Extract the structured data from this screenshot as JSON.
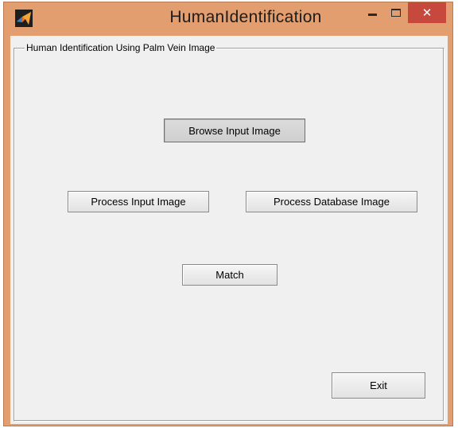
{
  "window": {
    "title": "HumanIdentification",
    "close_glyph": "✕",
    "icon": "matlab-icon"
  },
  "panel": {
    "title": "Human Identification Using Palm Vein Image"
  },
  "buttons": {
    "browse": "Browse Input Image",
    "process_input": "Process Input Image",
    "process_database": "Process Database Image",
    "match": "Match",
    "exit": "Exit"
  },
  "colors": {
    "frame": "#e39e6f",
    "close_button": "#c7483d",
    "client_background": "#f0f0f0"
  }
}
